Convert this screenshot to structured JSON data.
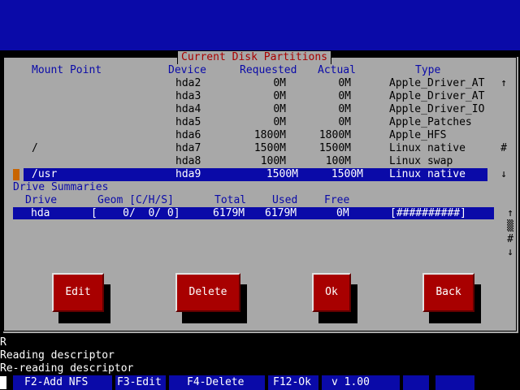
{
  "dialog": {
    "title": "Current Disk Partitions",
    "headers": {
      "mount": "Mount Point",
      "device": "Device",
      "requested": "Requested",
      "actual": "Actual",
      "type": "Type"
    },
    "partitions": [
      {
        "mount": "",
        "device": "hda2",
        "requested": "0M",
        "actual": "0M",
        "type": "Apple_Driver_AT"
      },
      {
        "mount": "",
        "device": "hda3",
        "requested": "0M",
        "actual": "0M",
        "type": "Apple_Driver_AT"
      },
      {
        "mount": "",
        "device": "hda4",
        "requested": "0M",
        "actual": "0M",
        "type": "Apple_Driver_IO"
      },
      {
        "mount": "",
        "device": "hda5",
        "requested": "0M",
        "actual": "0M",
        "type": "Apple_Patches"
      },
      {
        "mount": "",
        "device": "hda6",
        "requested": "1800M",
        "actual": "1800M",
        "type": "Apple_HFS"
      },
      {
        "mount": "/",
        "device": "hda7",
        "requested": "1500M",
        "actual": "1500M",
        "type": "Linux native"
      },
      {
        "mount": "",
        "device": "hda8",
        "requested": "100M",
        "actual": "100M",
        "type": "Linux swap"
      },
      {
        "mount": "/usr",
        "device": "hda9",
        "requested": "1500M",
        "actual": "1500M",
        "type": "Linux native"
      }
    ],
    "scroll_arrows": {
      "up": "↑",
      "thumb": "#",
      "down": "↓"
    },
    "drive_summaries": {
      "label": "Drive Summaries",
      "headers": {
        "drive": "Drive",
        "geom": "Geom [C/H/S]",
        "total": "Total",
        "used": "Used",
        "free": "Free"
      },
      "rows": [
        {
          "drive": "hda",
          "geom": "[    0/  0/ 0]",
          "total": "6179M",
          "used": "6179M",
          "free": "0M",
          "bar": "[##########]"
        }
      ],
      "scroll_arrows": {
        "up": "↑",
        "track": "▒",
        "thumb": "#",
        "down": "↓"
      }
    },
    "buttons": {
      "edit": "Edit",
      "delete": "Delete",
      "ok": "Ok",
      "back": "Back"
    }
  },
  "console": {
    "lines": [
      "R",
      "Reading descriptor",
      "Re-reading descriptor"
    ]
  },
  "statusbar": {
    "f2": "F2-Add NFS",
    "f3": "F3-Edit",
    "f4": "F4-Delete",
    "f12": "F12-Ok",
    "version": "v 1.00"
  }
}
